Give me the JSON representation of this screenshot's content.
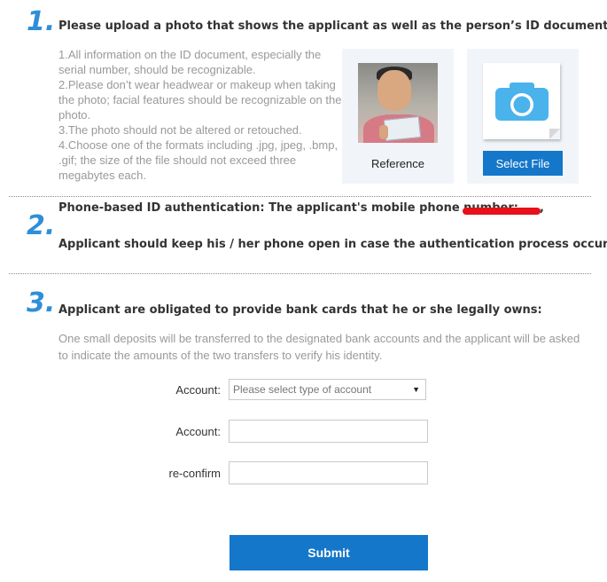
{
  "step1": {
    "number": "1.",
    "title": "Please upload a photo that shows the applicant as well as the person’s ID document.",
    "instructions": [
      "1.All information on the ID document, especially the serial number, should be recognizable.",
      "2.Please don’t wear headwear or makeup when taking the photo; facial features should be recognizable on the photo.",
      "3.The photo should not be altered or retouched.",
      "4.Choose one of the formats including .jpg, jpeg, .bmp, .gif; the size of the file should not exceed three megabytes each."
    ],
    "reference_caption": "Reference",
    "select_file_label": "Select File"
  },
  "step2": {
    "number": "2.",
    "line1": "Phone-based ID authentication:  The applicant's mobile phone number:",
    "line1_end": ",",
    "line2": "Applicant should keep his / her phone open in case the authentication process occurs."
  },
  "step3": {
    "number": "3.",
    "title": "Applicant are obligated to provide bank cards that he or she legally owns:",
    "description": "One small deposits will be transferred to the designated bank accounts and the applicant will be asked to indicate the amounts of the two transfers to verify his identity."
  },
  "form": {
    "account_type_label": "Account:",
    "account_type_placeholder": "Please select type of account",
    "account_label": "Account:",
    "account_value": "",
    "reconfirm_label": "re-confirm",
    "reconfirm_value": "",
    "submit_label": "Submit"
  },
  "colors": {
    "accent": "#2e8fd8",
    "button": "#1577c9",
    "camera_icon": "#4ab3ec",
    "redaction": "#e8101a"
  },
  "icons": {
    "upload_tile": "camera-icon",
    "select_caret": "caret-down-icon"
  }
}
